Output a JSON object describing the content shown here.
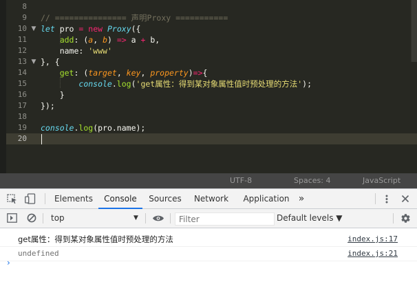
{
  "editor": {
    "line_numbers": [
      "8",
      "9",
      "10",
      "11",
      "12",
      "13",
      "14",
      "15",
      "16",
      "17",
      "18",
      "19",
      "20"
    ],
    "lines": [
      [],
      [
        {
          "c": "comment",
          "t": "// =============== 声明Proxy ==========="
        }
      ],
      [
        {
          "c": "kw",
          "t": "let"
        },
        {
          "c": "plain",
          "t": " pro "
        },
        {
          "c": "op",
          "t": "="
        },
        {
          "c": "plain",
          "t": " "
        },
        {
          "c": "op",
          "t": "new"
        },
        {
          "c": "plain",
          "t": " "
        },
        {
          "c": "cls",
          "t": "Proxy"
        },
        {
          "c": "plain",
          "t": "({"
        }
      ],
      [
        {
          "c": "plain",
          "t": "    "
        },
        {
          "c": "fn",
          "t": "add"
        },
        {
          "c": "plain",
          "t": ": ("
        },
        {
          "c": "param",
          "t": "a"
        },
        {
          "c": "plain",
          "t": ", "
        },
        {
          "c": "param",
          "t": "b"
        },
        {
          "c": "plain",
          "t": ") "
        },
        {
          "c": "op",
          "t": "=>"
        },
        {
          "c": "plain",
          "t": " a "
        },
        {
          "c": "op",
          "t": "+"
        },
        {
          "c": "plain",
          "t": " b,"
        }
      ],
      [
        {
          "c": "plain",
          "t": "    name: "
        },
        {
          "c": "str",
          "t": "'www'"
        }
      ],
      [
        {
          "c": "plain",
          "t": "}, {"
        }
      ],
      [
        {
          "c": "plain",
          "t": "    "
        },
        {
          "c": "fn",
          "t": "get"
        },
        {
          "c": "plain",
          "t": ": ("
        },
        {
          "c": "param",
          "t": "target"
        },
        {
          "c": "plain",
          "t": ", "
        },
        {
          "c": "param",
          "t": "key"
        },
        {
          "c": "plain",
          "t": ", "
        },
        {
          "c": "param",
          "t": "property"
        },
        {
          "c": "plain",
          "t": ")"
        },
        {
          "c": "op",
          "t": "=>"
        },
        {
          "c": "plain",
          "t": "{"
        }
      ],
      [
        {
          "c": "plain",
          "t": "        "
        },
        {
          "c": "builtin",
          "t": "console"
        },
        {
          "c": "plain",
          "t": "."
        },
        {
          "c": "fn",
          "t": "log"
        },
        {
          "c": "plain",
          "t": "("
        },
        {
          "c": "str",
          "t": "'get属性：得到某对象属性值时预处理的方法'"
        },
        {
          "c": "plain",
          "t": ");"
        }
      ],
      [
        {
          "c": "plain",
          "t": "    }"
        }
      ],
      [
        {
          "c": "plain",
          "t": "});"
        }
      ],
      [],
      [
        {
          "c": "builtin",
          "t": "console"
        },
        {
          "c": "plain",
          "t": "."
        },
        {
          "c": "fn",
          "t": "log"
        },
        {
          "c": "plain",
          "t": "(pro.name);"
        }
      ],
      []
    ],
    "fold_marker": "▼"
  },
  "statusbar": {
    "encoding": "UTF-8",
    "indent": "Spaces: 4",
    "language": "JavaScript"
  },
  "devtools": {
    "tabs": [
      "Elements",
      "Console",
      "Sources",
      "Network",
      "Application"
    ],
    "active_tab": "Console",
    "more_tabs": "»",
    "context": "top",
    "filter_placeholder": "Filter",
    "levels": "Default levels ▼",
    "messages": [
      {
        "text": "get属性：得到某对象属性值时预处理的方法",
        "source": "index.js:17"
      },
      {
        "text": "undefined",
        "source": "index.js:21"
      }
    ],
    "prompt": "›",
    "accent": "#1a73e8"
  }
}
